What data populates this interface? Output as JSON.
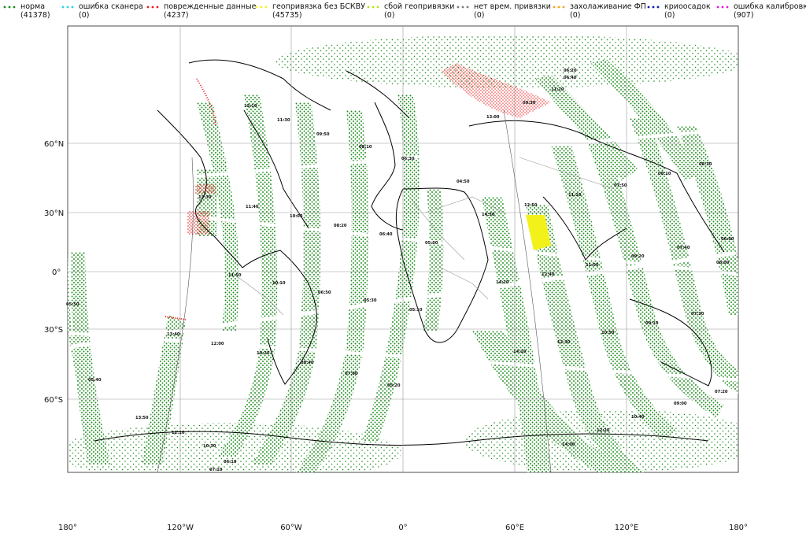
{
  "legend": {
    "items": [
      {
        "label": "норма",
        "count": "(41378)",
        "color": "#1a8a1a"
      },
      {
        "label": "ошибка сканера",
        "count": "(0)",
        "color": "#22d3ee"
      },
      {
        "label": "поврежденные данные",
        "count": "(4237)",
        "color": "#ef1c1c"
      },
      {
        "label": "геопривязка без БСКВУ",
        "count": "(45735)",
        "color": "#f2f21a"
      },
      {
        "label": "сбой геопривязки",
        "count": "(0)",
        "color": "#b6e21a"
      },
      {
        "label": "нет врем. привязки",
        "count": "(0)",
        "color": "#7a7a7a"
      },
      {
        "label": "захолаживание ФП",
        "count": "(0)",
        "color": "#f5a21a"
      },
      {
        "label": "криоосадок",
        "count": "(0)",
        "color": "#0a18a8"
      },
      {
        "label": "ошибка калибровки",
        "count": "(907)",
        "color": "#e11ae1"
      }
    ]
  },
  "axes": {
    "lat_ticks": [
      "60°N",
      "30°N",
      "0°",
      "30°S",
      "60°S"
    ],
    "lon_ticks": [
      "180°",
      "120°W",
      "60°W",
      "0°",
      "60°E",
      "120°E",
      "180°"
    ]
  },
  "swath_times": [
    "13:10",
    "11:30",
    "09:50",
    "08:10",
    "06:30",
    "04:50",
    "13:30",
    "11:40",
    "10:00",
    "08:20",
    "06:40",
    "05:00",
    "13:40",
    "12:00",
    "10:20",
    "08:40",
    "07:00",
    "05:20",
    "13:50",
    "12:10",
    "10:30",
    "14:30",
    "12:50",
    "14:20",
    "12:40",
    "11:00",
    "09:20",
    "07:40",
    "06:00",
    "14:10",
    "12:30",
    "10:50",
    "09:10",
    "07:30",
    "14:00",
    "12:20",
    "10:40",
    "09:00",
    "07:20",
    "06:20",
    "06:40",
    "08:30",
    "08:10",
    "07:50",
    "09:30",
    "11:10",
    "11:50",
    "13:00",
    "11:20",
    "10:10",
    "05:10",
    "08:00",
    "06:50",
    "05:30",
    "05:50",
    "07:10",
    "06:10",
    "05:40"
  ],
  "colors": {
    "norm": "#1a8a1a",
    "damaged": "#ef1c1c",
    "nobskvu": "#f2f21a",
    "calib": "#e11ae1",
    "grid": "#9a9a9a",
    "coast": "#000000",
    "border": "#9a9a9a"
  }
}
